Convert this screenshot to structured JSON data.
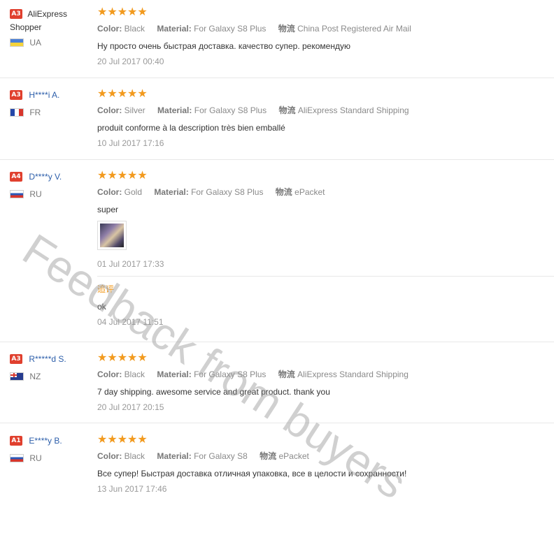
{
  "colors": {
    "accent_star": "#f29a1e",
    "badge": "#e0402e",
    "link": "#2c5eaa",
    "watermark": "#969696"
  },
  "labels": {
    "color": "Color:",
    "material": "Material:",
    "shipping": "物流"
  },
  "reviews": [
    {
      "badge": "A3",
      "name": "AliExpress Shopper",
      "country": "UA",
      "flag_icon": "ukraine-flag-icon",
      "stars": "★★★★★",
      "color": "Black",
      "material": "For Galaxy S8 Plus",
      "shipping": "China Post Registered Air Mail",
      "text": "Ну просто очень быстрая доставка. качество супер. рекомендую",
      "date": "20 Jul 2017 00:40"
    },
    {
      "badge": "A3",
      "name": "H****i A.",
      "country": "FR",
      "flag_icon": "france-flag-icon",
      "stars": "★★★★★",
      "color": "Silver",
      "material": "For Galaxy S8 Plus",
      "shipping": "AliExpress Standard Shipping",
      "text": "produit conforme à la description très bien emballé",
      "date": "10 Jul 2017 17:16"
    },
    {
      "badge": "A4",
      "name": "D****y V.",
      "country": "RU",
      "flag_icon": "russia-flag-icon",
      "stars": "★★★★★",
      "color": "Gold",
      "material": "For Galaxy S8 Plus",
      "shipping": "ePacket",
      "text": "super",
      "date": "01 Jul 2017 17:33",
      "append_label": "追评",
      "append_text": "ok",
      "append_date": "04 Jul 2017 11:51"
    },
    {
      "badge": "A3",
      "name": "R*****d S.",
      "country": "NZ",
      "flag_icon": "new-zealand-flag-icon",
      "stars": "★★★★★",
      "color": "Black",
      "material": "For Galaxy S8 Plus",
      "shipping": "AliExpress Standard Shipping",
      "text": "7 day shipping. awesome service and great product. thank you",
      "date": "20 Jul 2017 20:15"
    },
    {
      "badge": "A1",
      "name": "E****y B.",
      "country": "RU",
      "flag_icon": "russia-flag-icon",
      "stars": "★★★★★",
      "color": "Black",
      "material": "For Galaxy S8",
      "shipping": "ePacket",
      "text": "Все супер! Быстрая доставка отличная упаковка, все в целости и сохранности!",
      "date": "13 Jun 2017 17:46"
    }
  ],
  "watermark": "Feedback from buyers"
}
